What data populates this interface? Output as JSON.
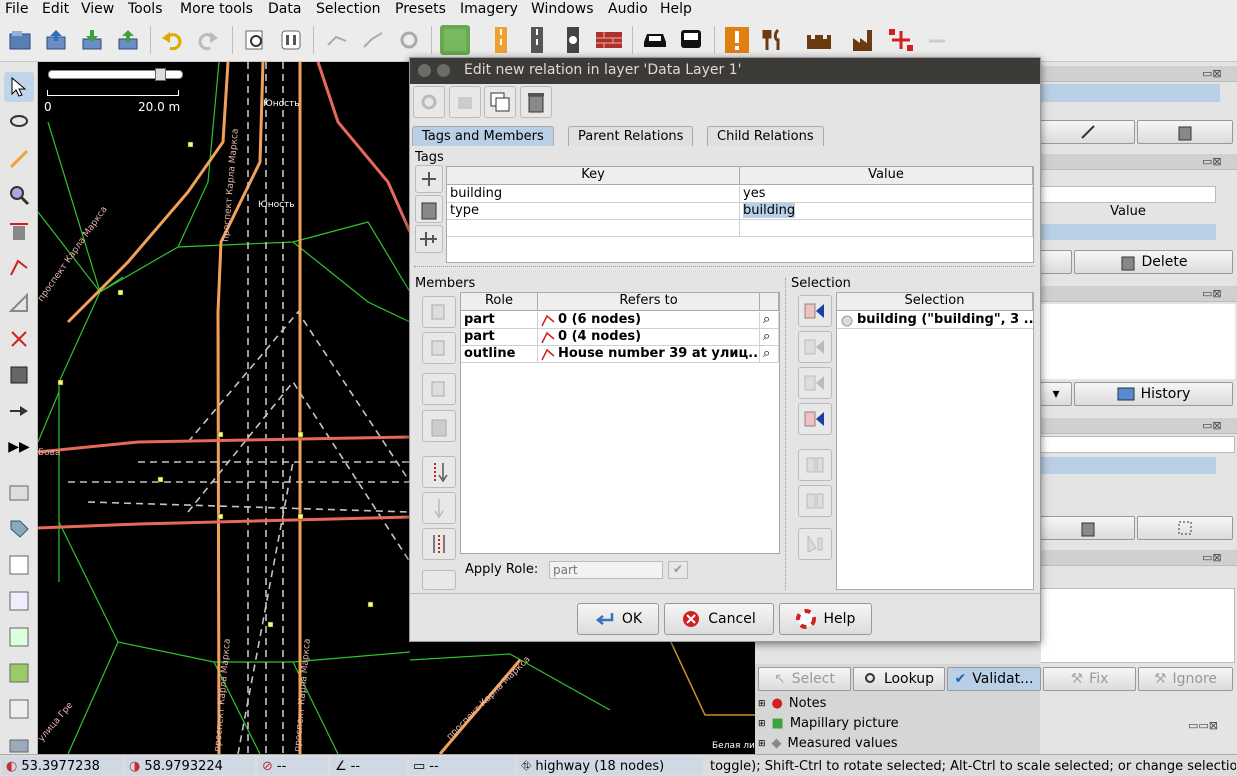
{
  "menu": [
    "File",
    "Edit",
    "View",
    "Tools",
    "More tools",
    "Data",
    "Selection",
    "Presets",
    "Imagery",
    "Windows",
    "Audio",
    "Help"
  ],
  "map": {
    "scale_left": "0",
    "scale_right": "20.0 m",
    "labels": [
      "Юность",
      "Юность",
      "проспект Карла Маркса",
      "проспект Карла Маркса",
      "проспект Карла Маркса",
      "проспект Карла Маркса",
      "Бова",
      "улица Гре",
      "Белая ли"
    ]
  },
  "dialog": {
    "title": "Edit new relation in layer 'Data Layer 1'",
    "tabs": [
      "Tags and Members",
      "Parent Relations",
      "Child Relations"
    ],
    "tags_title": "Tags",
    "tags_headers": {
      "key": "Key",
      "value": "Value"
    },
    "tags": [
      {
        "key": "building",
        "value": "yes"
      },
      {
        "key": "type",
        "value": "building"
      }
    ],
    "members_title": "Members",
    "members_headers": {
      "role": "Role",
      "refers": "Refers to"
    },
    "members": [
      {
        "role": "part",
        "refers": "0 (6 nodes)"
      },
      {
        "role": "part",
        "refers": "0 (4 nodes)"
      },
      {
        "role": "outline",
        "refers": "House number 39 at улиц..."
      }
    ],
    "selection_title": "Selection",
    "selection_header": "Selection",
    "selection_item": "building (\"building\", 3 ...",
    "apply_role_label": "Apply Role:",
    "apply_role_placeholder": "part",
    "ok_label": "OK",
    "cancel_label": "Cancel",
    "help_label": "Help"
  },
  "right": {
    "value_header": "Value",
    "delete_label": "Delete",
    "history_label": "History",
    "select_label": "Select",
    "lookup_label": "Lookup",
    "validate_label": "Validat...",
    "fix_label": "Fix",
    "ignore_label": "Ignore",
    "panels": [
      "Notes",
      "Mapillary picture",
      "Measured values"
    ]
  },
  "status": {
    "lat": "53.3977238",
    "lon": "58.9793224",
    "heading": "--",
    "angle": "--",
    "distance": "--",
    "info": "highway (18 nodes)",
    "help": "toggle); Shift-Ctrl to rotate selected; Alt-Ctrl to scale selected; or change selection"
  },
  "colors": {
    "accent": "#b8cfe5",
    "title_bar": "#3c3b37",
    "map_bg": "#000000",
    "road_orange": "#f2a15a",
    "road_red": "#e66a5a",
    "way_green": "#2fc42f"
  }
}
